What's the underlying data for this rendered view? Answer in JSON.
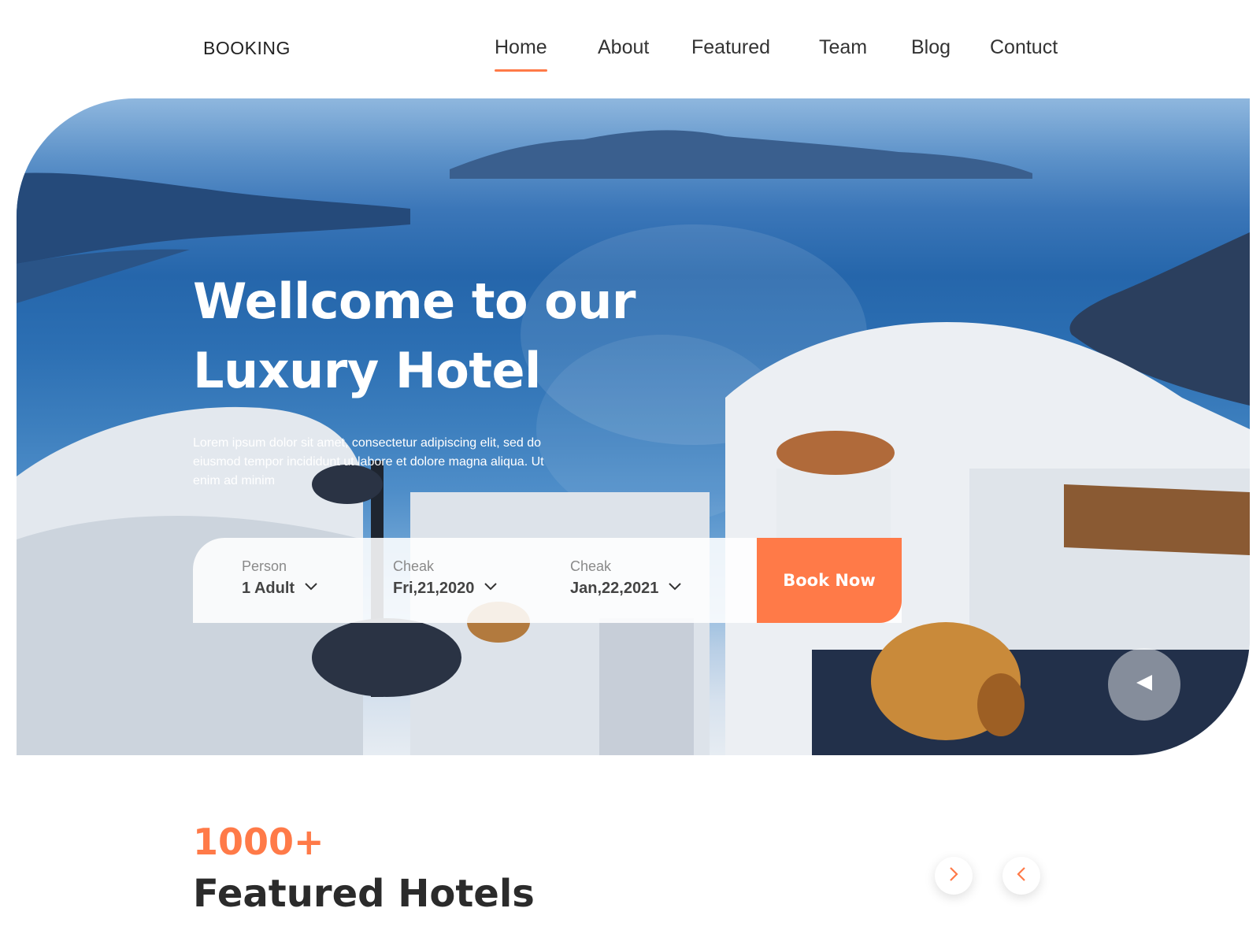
{
  "theme": {
    "accent": "#ff7a48",
    "text": "#2c2c2c"
  },
  "header": {
    "brand": "BOOKING",
    "nav": [
      {
        "label": "Home",
        "active": true
      },
      {
        "label": "About",
        "active": false
      },
      {
        "label": "Featured",
        "active": false
      },
      {
        "label": "Team",
        "active": false
      },
      {
        "label": "Blog",
        "active": false
      },
      {
        "label": "Contuct",
        "active": false
      }
    ]
  },
  "hero": {
    "title_line1": "Wellcome to our",
    "title_line2": "Luxury Hotel",
    "description": "Lorem ipsum dolor sit amet, consectetur adipiscing elit, sed do eiusmod tempor incididunt ut labore et dolore magna aliqua. Ut enim ad minim",
    "background": "santorini-seaview-photo",
    "play_icon": "play-icon"
  },
  "booking": {
    "person": {
      "label": "Person",
      "value": "1 Adult",
      "icon": "chevron-down-icon"
    },
    "checkin": {
      "label": "Cheak",
      "value": "Fri,21,2020",
      "icon": "chevron-down-icon"
    },
    "checkout": {
      "label": "Cheak",
      "value": "Jan,22,2021",
      "icon": "chevron-down-icon"
    },
    "book_button": "Book Now"
  },
  "featured": {
    "count": "1000+",
    "title": "Featured Hotels",
    "next_icon": "chevron-right-icon",
    "prev_icon": "chevron-left-icon"
  }
}
